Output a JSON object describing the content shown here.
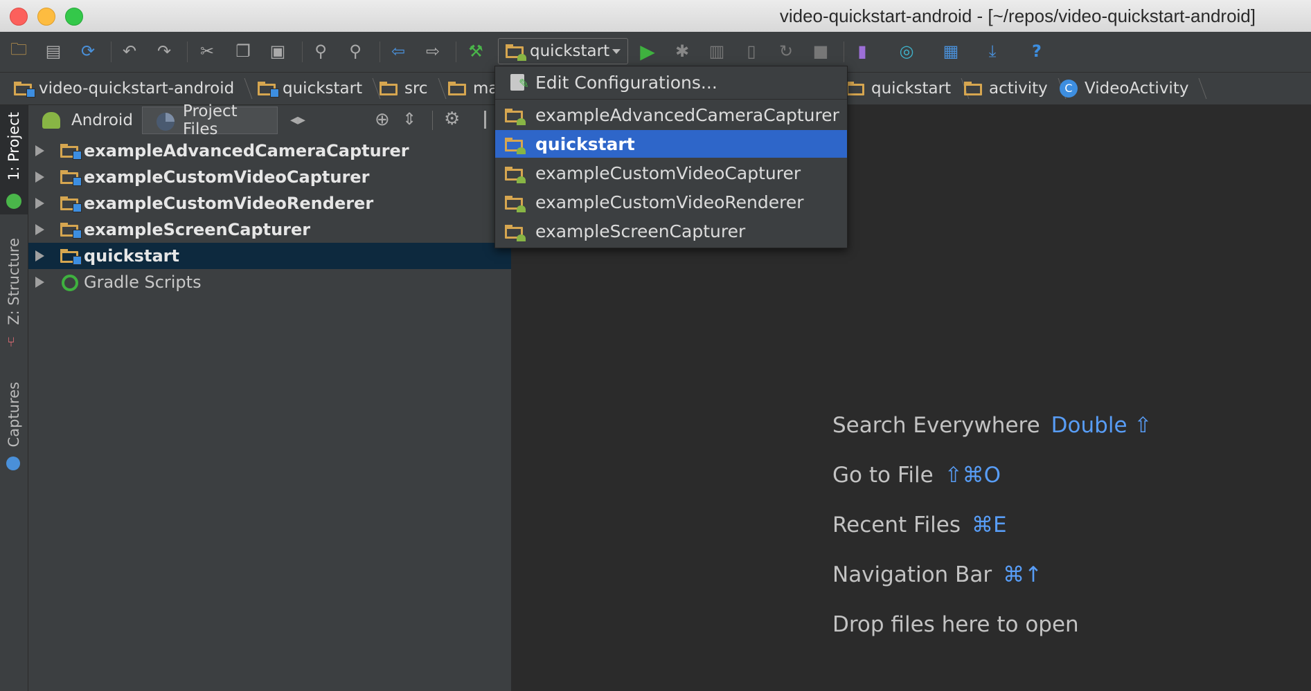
{
  "window": {
    "title": "video-quickstart-android - [~/repos/video-quickstart-android]"
  },
  "toolbar": {
    "run_config": "quickstart"
  },
  "breadcrumb": {
    "items": [
      "video-quickstart-android",
      "quickstart",
      "src",
      "ma",
      "quickstart",
      "activity",
      "VideoActivity"
    ]
  },
  "left_strip": {
    "project": "1: Project",
    "structure": "Z: Structure",
    "captures": "Captures"
  },
  "project_panel": {
    "tabs": {
      "android": "Android",
      "project_files": "Project Files"
    },
    "tree": [
      "exampleAdvancedCameraCapturer",
      "exampleCustomVideoCapturer",
      "exampleCustomVideoRenderer",
      "exampleScreenCapturer",
      "quickstart",
      "Gradle Scripts"
    ],
    "selected": "quickstart"
  },
  "run_config_popup": {
    "edit": "Edit Configurations...",
    "items": [
      "exampleAdvancedCameraCapturer",
      "quickstart",
      "exampleCustomVideoCapturer",
      "exampleCustomVideoRenderer",
      "exampleScreenCapturer"
    ],
    "selected": "quickstart"
  },
  "editor_hints": [
    {
      "label": "Search Everywhere",
      "key": "Double ⇧"
    },
    {
      "label": "Go to File",
      "key": "⇧⌘O"
    },
    {
      "label": "Recent Files",
      "key": "⌘E"
    },
    {
      "label": "Navigation Bar",
      "key": "⌘↑"
    },
    {
      "label": "Drop files here to open",
      "key": ""
    }
  ],
  "colors": {
    "accent": "#589df6",
    "selection": "#2e66c9",
    "folder": "#d6a650",
    "run_green": "#3fb13f"
  }
}
